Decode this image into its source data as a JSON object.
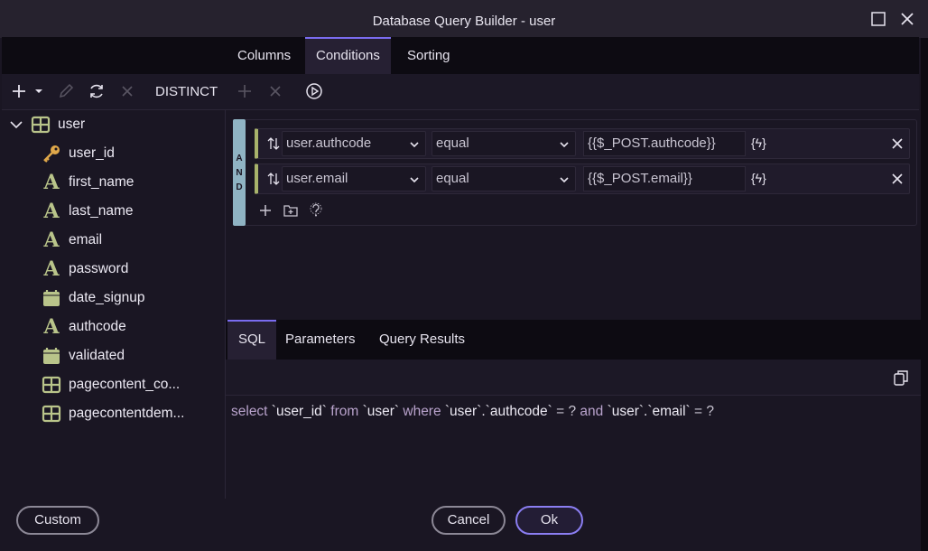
{
  "window": {
    "title": "Database Query Builder - user"
  },
  "tabs": [
    {
      "label": "Columns"
    },
    {
      "label": "Conditions"
    },
    {
      "label": "Sorting"
    }
  ],
  "toolbar": {
    "distinct_label": "DISTINCT"
  },
  "tree": {
    "root": "user",
    "items": [
      {
        "label": "user_id",
        "icon": "key-icon"
      },
      {
        "label": "first_name",
        "icon": "text-field-icon"
      },
      {
        "label": "last_name",
        "icon": "text-field-icon"
      },
      {
        "label": "email",
        "icon": "text-field-icon"
      },
      {
        "label": "password",
        "icon": "text-field-icon"
      },
      {
        "label": "date_signup",
        "icon": "calendar-icon"
      },
      {
        "label": "authcode",
        "icon": "text-field-icon"
      },
      {
        "label": "validated",
        "icon": "calendar-icon"
      },
      {
        "label": "pagecontent_co...",
        "icon": "table-icon"
      },
      {
        "label": "pagecontentdem...",
        "icon": "table-icon"
      }
    ]
  },
  "conditions": {
    "group_label": "AND",
    "group_letters": [
      "A",
      "N",
      "D"
    ],
    "rules": [
      {
        "field": "user.authcode",
        "operator": "equal",
        "value": "{{$_POST.authcode}}",
        "dynamic": "{ϟ}"
      },
      {
        "field": "user.email",
        "operator": "equal",
        "value": "{{$_POST.email}}",
        "dynamic": "{ϟ}"
      }
    ]
  },
  "sql_tabs": [
    {
      "label": "SQL"
    },
    {
      "label": "Parameters"
    },
    {
      "label": "Query Results"
    }
  ],
  "sql": {
    "parts": [
      {
        "t": "select",
        "c": "kw"
      },
      {
        "t": " `user_id` ",
        "c": "id"
      },
      {
        "t": "from",
        "c": "kw"
      },
      {
        "t": " `user` ",
        "c": "id"
      },
      {
        "t": "where",
        "c": "kw"
      },
      {
        "t": " `user`.`authcode` ",
        "c": "id"
      },
      {
        "t": "= ? ",
        "c": "op"
      },
      {
        "t": "and",
        "c": "kw"
      },
      {
        "t": " `user`.`email` ",
        "c": "id"
      },
      {
        "t": "= ?",
        "c": "op"
      }
    ]
  },
  "footer": {
    "custom_label": "Custom",
    "cancel_label": "Cancel",
    "ok_label": "Ok"
  },
  "colors": {
    "accent": "#7a6cf0",
    "field_icon": "#b9c48a",
    "key_icon": "#e0a84a",
    "and_bar": "#8fb3c3"
  }
}
